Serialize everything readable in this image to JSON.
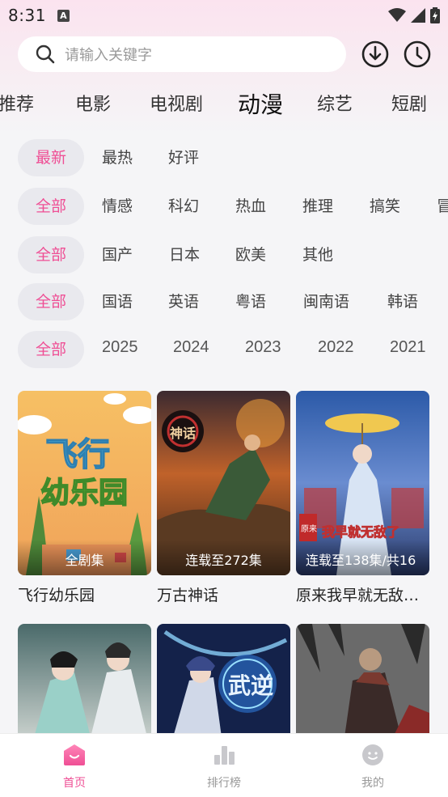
{
  "status_bar": {
    "time": "8:31",
    "notification_glyph": "A"
  },
  "search": {
    "placeholder": "请输入关键字"
  },
  "icons": {
    "search": "search-icon",
    "download": "download-icon",
    "history": "clock-icon"
  },
  "category_tabs": [
    {
      "label": "推荐"
    },
    {
      "label": "电影"
    },
    {
      "label": "电视剧"
    },
    {
      "label": "动漫",
      "active": true
    },
    {
      "label": "综艺"
    },
    {
      "label": "短剧"
    }
  ],
  "filters": {
    "sort": [
      "最新",
      "最热",
      "好评"
    ],
    "genre": [
      "全部",
      "情感",
      "科幻",
      "热血",
      "推理",
      "搞笑",
      "冒"
    ],
    "region": [
      "全部",
      "国产",
      "日本",
      "欧美",
      "其他"
    ],
    "language": [
      "全部",
      "国语",
      "英语",
      "粤语",
      "闽南语",
      "韩语"
    ],
    "year": [
      "全部",
      "2025",
      "2024",
      "2023",
      "2022",
      "2021"
    ]
  },
  "posters": {
    "card1_logo_line1": "飞行",
    "card1_logo_line2": "幼乐园",
    "card2_seal": "神话",
    "card3_seal": "原来",
    "card3_logo": "我早就无敌了",
    "card5_logo": "武逆"
  },
  "cards": [
    {
      "title": "飞行幼乐园",
      "badge": "全剧集"
    },
    {
      "title": "万古神话",
      "badge": "连载至272集"
    },
    {
      "title": "原来我早就无敌…",
      "badge": "连载至138集/共16"
    },
    {
      "title": "",
      "badge": ""
    },
    {
      "title": "",
      "badge": ""
    },
    {
      "title": "",
      "badge": ""
    }
  ],
  "bottom_nav": [
    {
      "label": "首页",
      "icon": "home-icon",
      "active": true
    },
    {
      "label": "排行榜",
      "icon": "chart-icon"
    },
    {
      "label": "我的",
      "icon": "profile-icon"
    }
  ],
  "colors": {
    "accent": "#ef4f95",
    "chip_bg": "#e9e9ee",
    "page_bg": "#f5f5f7"
  }
}
